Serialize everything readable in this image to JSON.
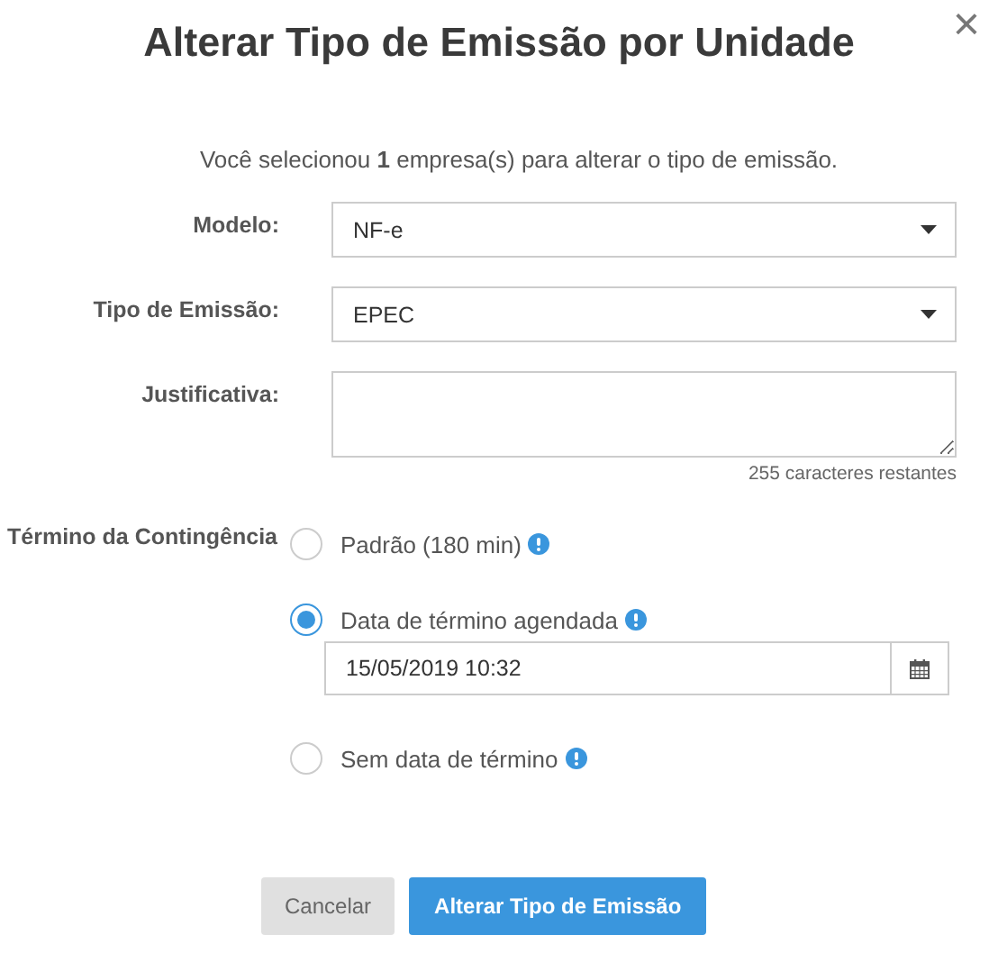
{
  "dialog": {
    "title": "Alterar Tipo de Emissão por Unidade",
    "close": "×"
  },
  "intro": "Você selecionou **1** empresa(s) para alterar o tipo de emissão.",
  "fields": [
    {
      "kind": "select",
      "label": "Modelo:",
      "value": "NF-e"
    },
    {
      "kind": "select",
      "label": "Tipo de Emissão:",
      "value": "EPEC"
    },
    {
      "kind": "textarea",
      "label": "Justificativa:",
      "counter": "255 caracteres restantes"
    }
  ],
  "contingency": {
    "label": "Término da Contingência",
    "options": [
      {
        "label": "Padrão (180 min)",
        "selected": false
      },
      {
        "label": "Data de término agendada",
        "selected": true,
        "date_value": "15/05/2019 10:32"
      },
      {
        "label": "Sem data de término",
        "selected": false
      }
    ]
  },
  "buttons": [
    {
      "kind": "secondary",
      "label": "Cancelar"
    },
    {
      "kind": "primary",
      "label": "Alterar Tipo de Emissão"
    }
  ]
}
